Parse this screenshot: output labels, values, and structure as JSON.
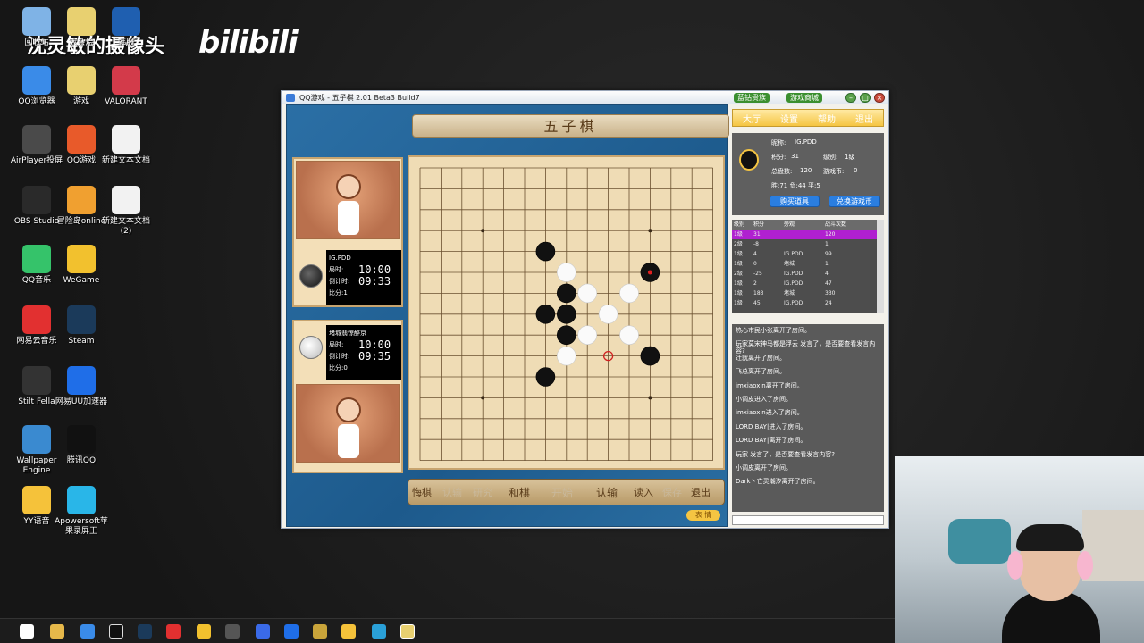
{
  "overlay": {
    "title": "沈灵敏的摄像头",
    "brand": "bilibili"
  },
  "desktop_icons": [
    {
      "label": "回收站",
      "color": "#7fb3e6"
    },
    {
      "label": "大杂烩",
      "color": "#e8d070"
    },
    {
      "label": "韩服",
      "color": "#1f5fb0"
    },
    {
      "label": "QQ浏览器",
      "color": "#3a8be8"
    },
    {
      "label": "游戏",
      "color": "#e8d070"
    },
    {
      "label": "VALORANT",
      "color": "#d33a4a"
    },
    {
      "label": "AirPlayer投屏",
      "color": "#4a4a4a"
    },
    {
      "label": "QQ游戏",
      "color": "#e85a2a"
    },
    {
      "label": "新建文本文档",
      "color": "#f2f2f2"
    },
    {
      "label": "OBS Studio",
      "color": "#2a2a2a"
    },
    {
      "label": "冒险岛online",
      "color": "#f0a030"
    },
    {
      "label": "新建文本文档 (2)",
      "color": "#f2f2f2"
    },
    {
      "label": "QQ音乐",
      "color": "#35c36a"
    },
    {
      "label": "WeGame",
      "color": "#f2c12e"
    },
    {
      "label": "网易云音乐",
      "color": "#e23030"
    },
    {
      "label": "Steam",
      "color": "#1b3a5a"
    },
    {
      "label": "Stilt Fella",
      "color": "#333333"
    },
    {
      "label": "网易UU加速器",
      "color": "#1f6ee8"
    },
    {
      "label": "Wallpaper Engine",
      "color": "#3a8ad0"
    },
    {
      "label": "腾讯QQ",
      "color": "#111111"
    },
    {
      "label": "YY语音",
      "color": "#f5c23a"
    },
    {
      "label": "Apowersoft苹果录屏王",
      "color": "#29b6e8"
    }
  ],
  "window": {
    "title": "QQ游戏 - 五子棋   2.01 Beta3 Build7",
    "top_buttons": [
      "蓝钻贵族",
      "游戏商城"
    ],
    "banner": "五子棋",
    "player_top": {
      "name": "IG.PDD",
      "step_label": "局时:",
      "step_time": "10:00",
      "count_label": "倒计时:",
      "count_time": "09:33",
      "score": "比分:1"
    },
    "player_bottom": {
      "name": "堵城翡惊醉京",
      "step_label": "局时:",
      "step_time": "10:00",
      "count_label": "倒计时:",
      "count_time": "09:35",
      "score": "比分:0"
    },
    "bottom_buttons": [
      {
        "label": "悔棋",
        "enabled": true
      },
      {
        "label": "认输",
        "enabled": false
      },
      {
        "label": "研究",
        "enabled": false
      },
      {
        "label": "和棋",
        "enabled": true
      },
      {
        "label": "开始",
        "enabled": false
      },
      {
        "label": "认输",
        "enabled": true
      },
      {
        "label": "读入",
        "enabled": true
      },
      {
        "label": "保存",
        "enabled": false
      },
      {
        "label": "退出",
        "enabled": true
      }
    ],
    "face_button": "表 情",
    "menu": [
      "大厅",
      "设置",
      "帮助",
      "退出"
    ],
    "user": {
      "nickname_label": "昵称:",
      "nickname": "IG.PDD",
      "points_label": "积分:",
      "points": "31",
      "level_label": "级别:",
      "level": "1级",
      "games_label": "总盘数:",
      "games": "120",
      "coins_label": "游戏币:",
      "coins": "0",
      "record": "胜:71  负:44  平:5",
      "buy_button": "购买道具",
      "exchange_button": "兑换游戏币"
    },
    "table": {
      "headers": [
        "级别",
        "积分",
        "旁观",
        "战斗次数"
      ],
      "rows": [
        [
          "1级",
          "31",
          "",
          "120"
        ],
        [
          "2级",
          "-8",
          "",
          "1"
        ],
        [
          "1级",
          "4",
          "IG.PDD",
          "99"
        ],
        [
          "1级",
          "0",
          "堵城",
          "1"
        ],
        [
          "2级",
          "-25",
          "IG.PDD",
          "4"
        ],
        [
          "1级",
          "2",
          "IG.PDD",
          "47"
        ],
        [
          "1级",
          "183",
          "堵城",
          "330"
        ],
        [
          "1级",
          "45",
          "IG.PDD",
          "24"
        ]
      ]
    },
    "chat": [
      "热心市民小张离开了房间。",
      "玩家莫宋神马都是浮云 发言了，是否要查看发言内容?",
      "迁就离开了房间。",
      "    飞总离开了房间。",
      "imxiaoxin离开了房间。",
      "小调皮进入了房间。",
      "imxiaoxin进入了房间。",
      "LORD  BAY|进入了房间。",
      "LORD  BAY|离开了房间。",
      "玩家 发言了，是否要查看发言内容?",
      "小调皮离开了房间。",
      "Dark丶亡灵潮汐离开了房间。"
    ]
  },
  "board": {
    "size": 15,
    "stones": [
      {
        "color": "black",
        "col": 6,
        "row": 4
      },
      {
        "color": "white",
        "col": 7,
        "row": 5
      },
      {
        "color": "black",
        "col": 11,
        "row": 5,
        "last": true
      },
      {
        "color": "black",
        "col": 7,
        "row": 6
      },
      {
        "color": "white",
        "col": 8,
        "row": 6
      },
      {
        "color": "white",
        "col": 10,
        "row": 6
      },
      {
        "color": "black",
        "col": 6,
        "row": 7
      },
      {
        "color": "black",
        "col": 7,
        "row": 7
      },
      {
        "color": "white",
        "col": 9,
        "row": 7
      },
      {
        "color": "black",
        "col": 7,
        "row": 8
      },
      {
        "color": "white",
        "col": 8,
        "row": 8
      },
      {
        "color": "white",
        "col": 10,
        "row": 8
      },
      {
        "color": "white",
        "col": 7,
        "row": 9
      },
      {
        "color": "black",
        "col": 11,
        "row": 9
      },
      {
        "color": "black",
        "col": 6,
        "row": 10
      }
    ],
    "forbidden_mark": {
      "col": 9,
      "row": 9
    }
  }
}
